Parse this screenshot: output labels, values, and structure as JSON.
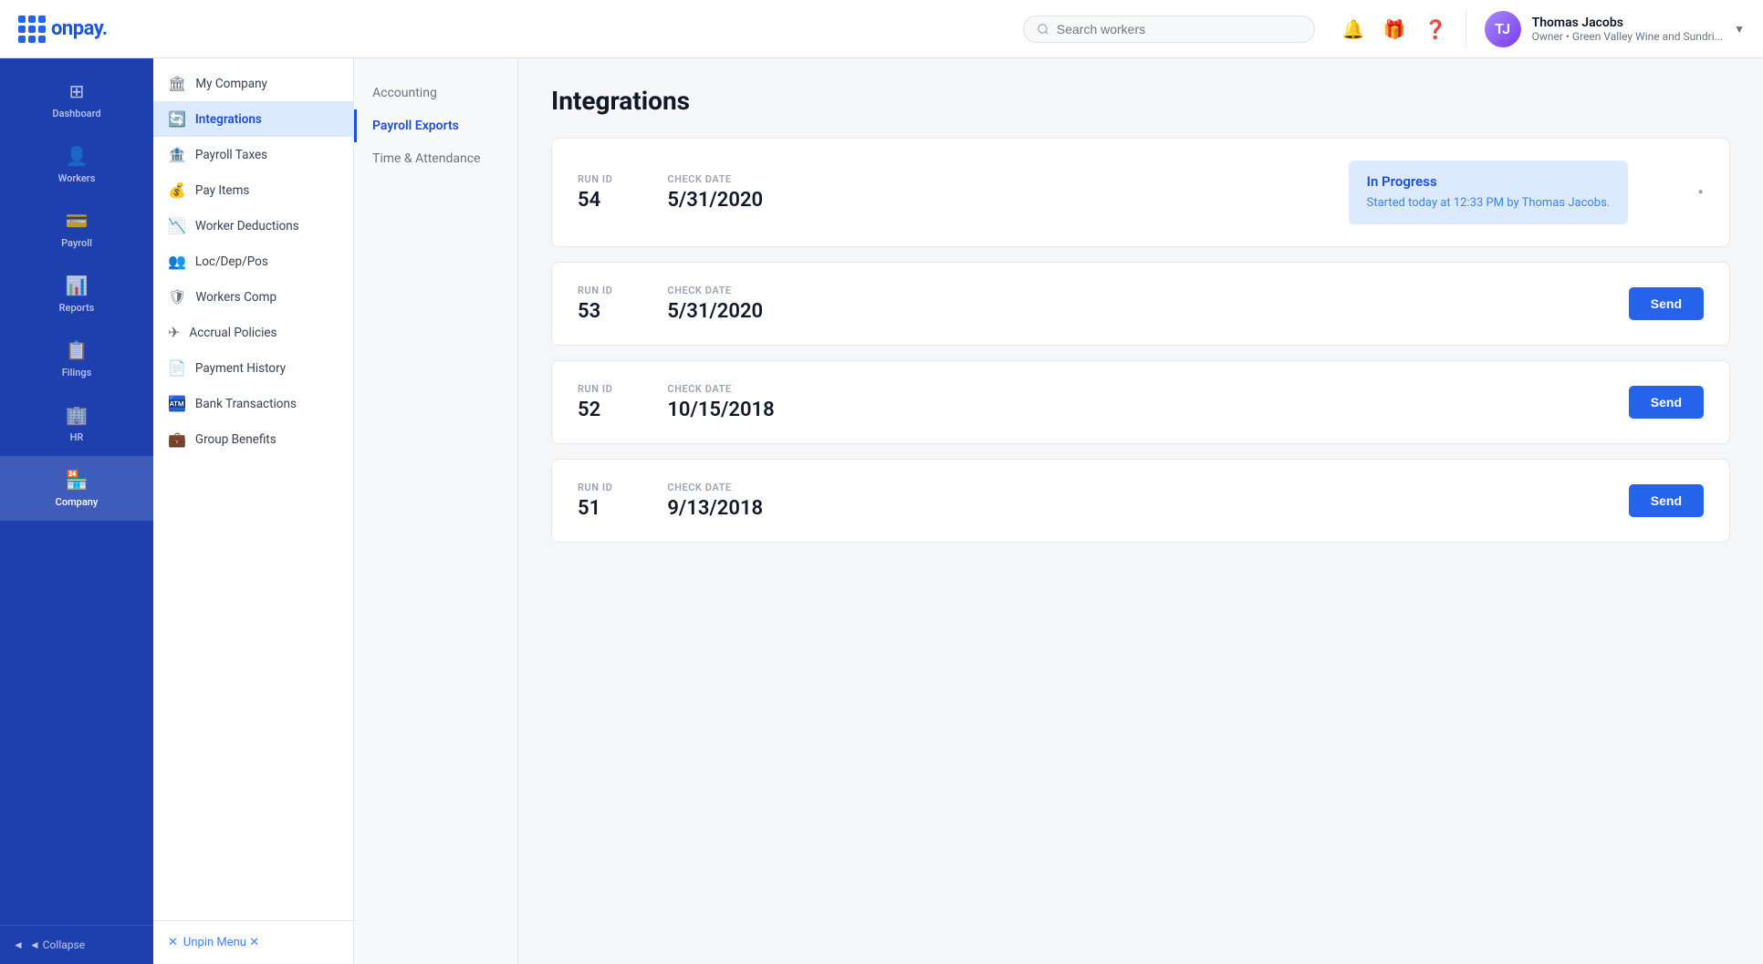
{
  "header": {
    "logo_text": "onpay.",
    "search_placeholder": "Search workers",
    "user": {
      "name": "Thomas Jacobs",
      "role": "Owner • Green Valley Wine and Sundri..."
    }
  },
  "primary_nav": {
    "items": [
      {
        "id": "dashboard",
        "label": "Dashboard",
        "icon": "⊞"
      },
      {
        "id": "workers",
        "label": "Workers",
        "icon": "👤"
      },
      {
        "id": "payroll",
        "label": "Payroll",
        "icon": "💳"
      },
      {
        "id": "reports",
        "label": "Reports",
        "icon": "📊"
      },
      {
        "id": "filings",
        "label": "Filings",
        "icon": "📋"
      },
      {
        "id": "hr",
        "label": "HR",
        "icon": "🏢"
      },
      {
        "id": "company",
        "label": "Company",
        "icon": "🏪",
        "active": true
      }
    ],
    "collapse_label": "◄ Collapse"
  },
  "secondary_nav": {
    "items": [
      {
        "id": "my-company",
        "label": "My Company",
        "icon": "🏛"
      },
      {
        "id": "integrations",
        "label": "Integrations",
        "icon": "🔄",
        "active": true
      },
      {
        "id": "payroll-taxes",
        "label": "Payroll Taxes",
        "icon": "🏦"
      },
      {
        "id": "pay-items",
        "label": "Pay Items",
        "icon": "💰"
      },
      {
        "id": "worker-deductions",
        "label": "Worker Deductions",
        "icon": "📉"
      },
      {
        "id": "loc-dep-pos",
        "label": "Loc/Dep/Pos",
        "icon": "👥"
      },
      {
        "id": "workers-comp",
        "label": "Workers Comp",
        "icon": "🛡"
      },
      {
        "id": "accrual-policies",
        "label": "Accrual Policies",
        "icon": "✈"
      },
      {
        "id": "payment-history",
        "label": "Payment History",
        "icon": "📄"
      },
      {
        "id": "bank-transactions",
        "label": "Bank Transactions",
        "icon": "🏧"
      },
      {
        "id": "group-benefits",
        "label": "Group Benefits",
        "icon": "💼"
      }
    ],
    "unpin_label": "Unpin Menu ✕"
  },
  "content_tabs": [
    {
      "id": "accounting",
      "label": "Accounting"
    },
    {
      "id": "payroll-exports",
      "label": "Payroll Exports",
      "active": true
    },
    {
      "id": "time-attendance",
      "label": "Time & Attendance"
    }
  ],
  "page": {
    "title": "Integrations"
  },
  "export_cards": [
    {
      "id": 1,
      "run_id_label": "RUN ID",
      "run_id": "54",
      "check_date_label": "CHECK DATE",
      "check_date": "5/31/2020",
      "status": "in_progress",
      "status_title": "In Progress",
      "status_text": "Started today at 12:33 PM by Thomas Jacobs."
    },
    {
      "id": 2,
      "run_id_label": "RUN ID",
      "run_id": "53",
      "check_date_label": "CHECK DATE",
      "check_date": "5/31/2020",
      "status": "send",
      "send_label": "Send"
    },
    {
      "id": 3,
      "run_id_label": "RUN ID",
      "run_id": "52",
      "check_date_label": "CHECK DATE",
      "check_date": "10/15/2018",
      "status": "send",
      "send_label": "Send"
    },
    {
      "id": 4,
      "run_id_label": "RUN ID",
      "run_id": "51",
      "check_date_label": "CHECK DATE",
      "check_date": "9/13/2018",
      "status": "send",
      "send_label": "Send"
    }
  ]
}
